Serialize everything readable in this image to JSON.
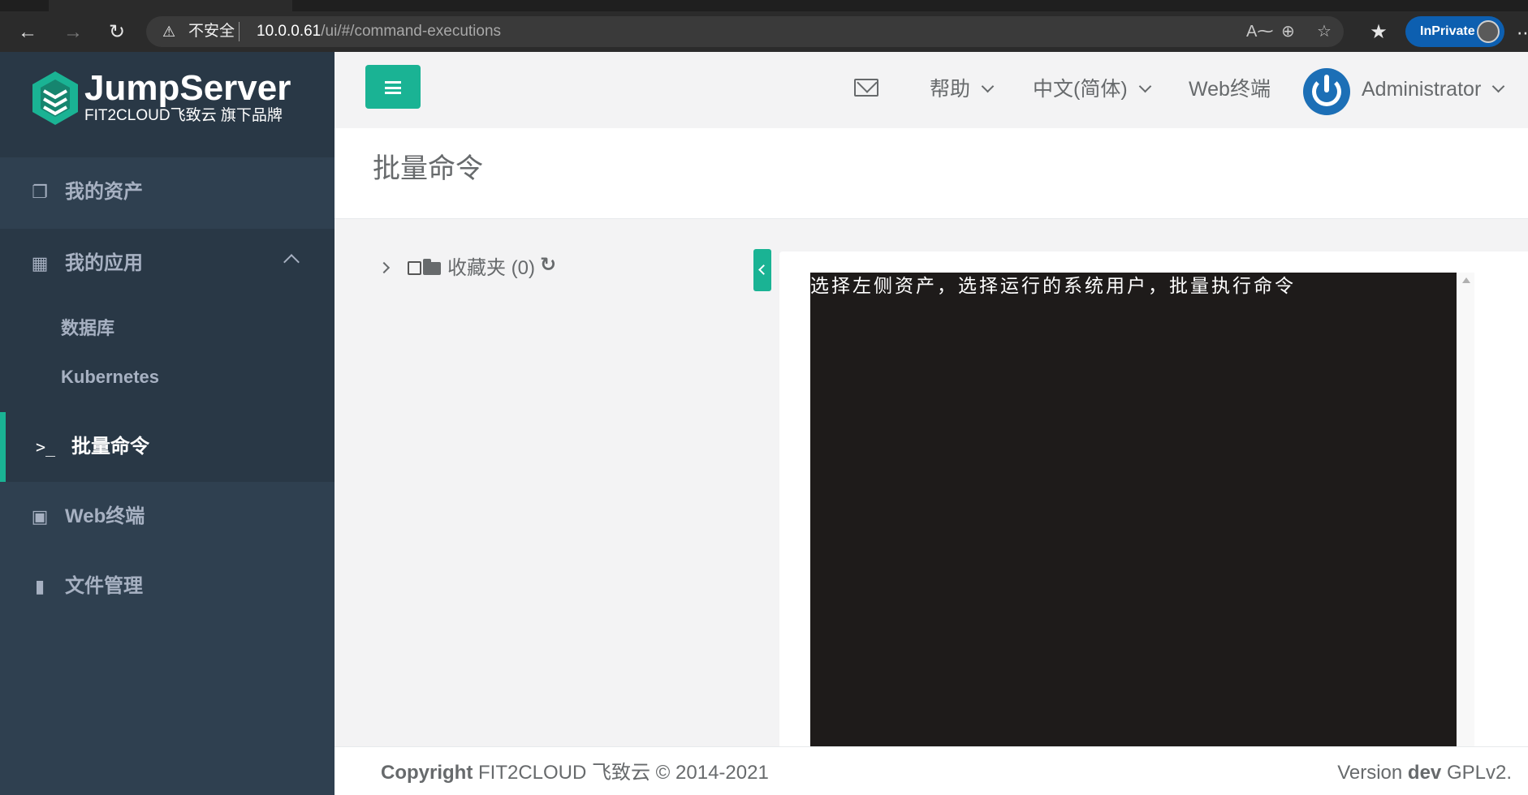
{
  "browser": {
    "insecure_label": "不安全",
    "url_host": "10.0.0.61",
    "url_path": "/ui/#/command-executions",
    "inprivate_label": "InPrivate"
  },
  "brand": {
    "name": "JumpServer",
    "subtitle": "FIT2CLOUD飞致云 旗下品牌",
    "accent_color": "#1ab394"
  },
  "sidebar": {
    "my_assets": "我的资产",
    "my_apps": "我的应用",
    "app_sub_items": [
      "数据库",
      "Kubernetes"
    ],
    "batch_command": "批量命令",
    "web_terminal": "Web终端",
    "file_manager": "文件管理"
  },
  "topbar": {
    "help": "帮助",
    "language": "中文(简体)",
    "web_terminal": "Web终端",
    "username": "Administrator"
  },
  "page": {
    "title": "批量命令"
  },
  "tree": {
    "root_label": "收藏夹 (0)"
  },
  "terminal": {
    "hint": "选择左侧资产，选择运行的系统用户，批量执行命令"
  },
  "footer": {
    "copyright_bold": "Copyright",
    "copyright_rest": " FIT2CLOUD 飞致云 © 2014-2021",
    "version_prefix": "Version ",
    "version_bold": "dev",
    "version_suffix": " GPLv2."
  }
}
